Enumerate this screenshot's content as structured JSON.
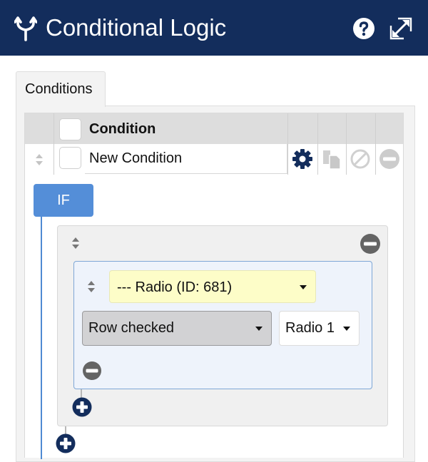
{
  "header": {
    "title": "Conditional Logic",
    "title_icon": "fork-icon",
    "help_icon": "question-circle-icon",
    "expand_icon": "expand-arrows-icon",
    "background": "#132d5c"
  },
  "tabs": [
    {
      "label": "Conditions",
      "active": true
    }
  ],
  "table": {
    "column_header": "Condition",
    "rows": [
      {
        "name": "New Condition",
        "actions": [
          {
            "icon": "gear-icon",
            "enabled": true
          },
          {
            "icon": "copy-icon",
            "enabled": false
          },
          {
            "icon": "disable-icon",
            "enabled": false
          },
          {
            "icon": "remove-icon",
            "enabled": false
          }
        ]
      }
    ]
  },
  "logic": {
    "if_label": "IF",
    "rule": {
      "field": "--- Radio (ID: 681)",
      "operator": "Row checked",
      "value": "Radio 1"
    }
  },
  "colors": {
    "accent_blue": "#548ed8",
    "navy": "#132d5c",
    "field_highlight": "#fdfdc8"
  }
}
